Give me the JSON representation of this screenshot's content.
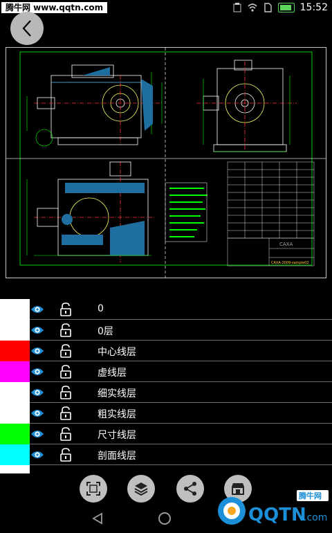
{
  "status_bar": {
    "watermark": "腾牛网 www.qqtn.com",
    "time": "15:52"
  },
  "layers": [
    {
      "name": "0",
      "color": "#ffffff"
    },
    {
      "name": "0层",
      "color": "#ffffff"
    },
    {
      "name": "中心线层",
      "color": "#ff0000"
    },
    {
      "name": "虚线层",
      "color": "#ff00ff"
    },
    {
      "name": "细实线层",
      "color": "#ffffff"
    },
    {
      "name": "粗实线层",
      "color": "#ffffff"
    },
    {
      "name": "尺寸线层",
      "color": "#00ff00"
    },
    {
      "name": "剖面线层",
      "color": "#00ffff"
    }
  ],
  "drawing": {
    "title_block_brand": "CAXA",
    "title_block_code": "CAXA-2009-sample02"
  },
  "watermark_br": {
    "brand": "QQTN",
    "domain": ".com",
    "site_name": "腾牛网"
  }
}
